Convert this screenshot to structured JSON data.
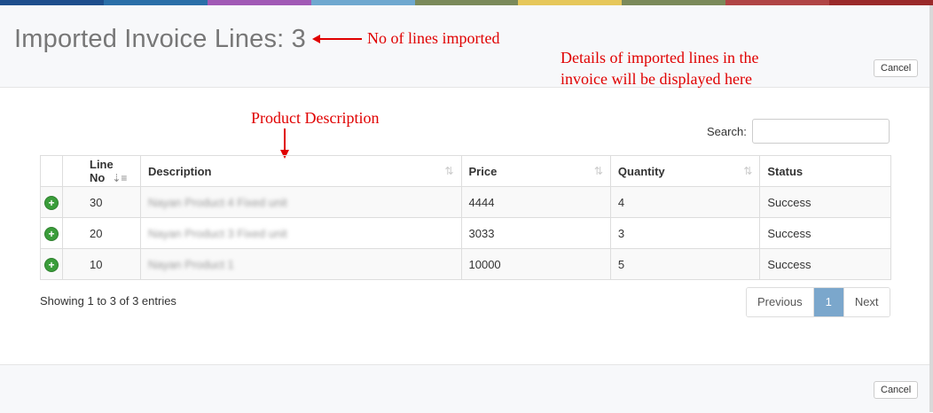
{
  "topbar_colors": [
    "#1e4e8c",
    "#2a6fa8",
    "#a15ab5",
    "#6fa8cf",
    "#7b8a5a",
    "#e6c75a",
    "#7b8a5a",
    "#b04545",
    "#9a2a2a"
  ],
  "header": {
    "title": "Imported Invoice Lines: 3",
    "cancel_label": "Cancel"
  },
  "annotations": {
    "lines_imported": "No of lines imported",
    "details_line1": "Details of imported lines in the",
    "details_line2": "invoice will be displayed here",
    "product_description": "Product Description"
  },
  "search": {
    "label": "Search:",
    "value": ""
  },
  "table": {
    "columns": [
      "Line No",
      "Description",
      "Price",
      "Quantity",
      "Status"
    ],
    "rows": [
      {
        "line_no": "30",
        "description": "Nayan Product 4 Fixed unit",
        "price": "4444",
        "quantity": "4",
        "status": "Success"
      },
      {
        "line_no": "20",
        "description": "Nayan Product 3 Fixed unit",
        "price": "3033",
        "quantity": "3",
        "status": "Success"
      },
      {
        "line_no": "10",
        "description": "Nayan Product 1",
        "price": "10000",
        "quantity": "5",
        "status": "Success"
      }
    ]
  },
  "info": "Showing 1 to 3 of 3 entries",
  "pagination": {
    "previous": "Previous",
    "current": "1",
    "next": "Next"
  },
  "footer": {
    "cancel_label": "Cancel"
  }
}
